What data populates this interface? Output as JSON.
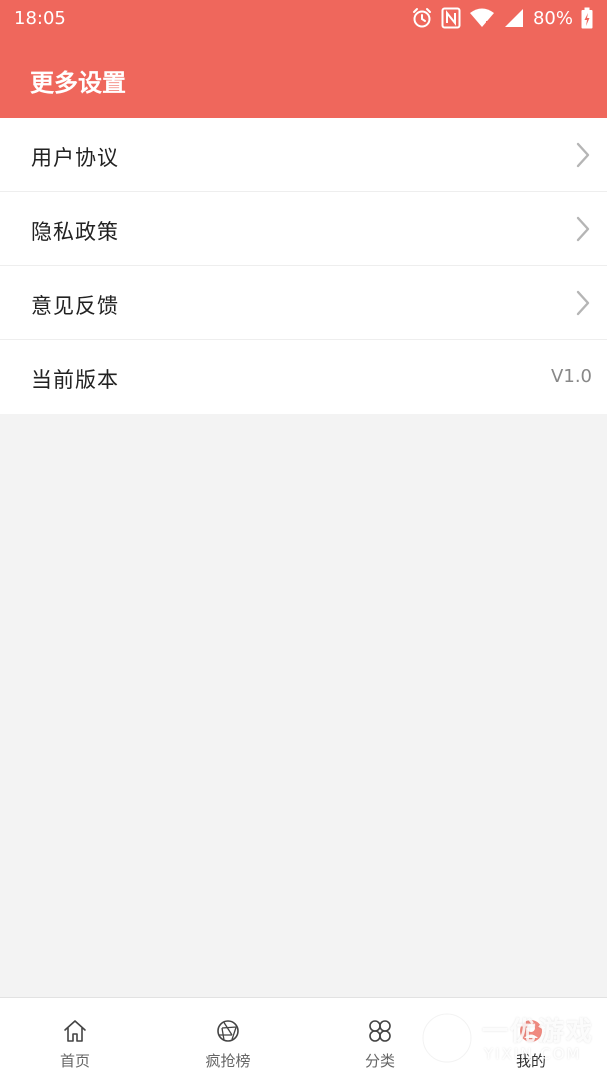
{
  "status_bar": {
    "time": "18:05",
    "battery": "80%",
    "icons": [
      "alarm-icon",
      "nfc-icon",
      "wifi-icon",
      "signal-icon",
      "battery-icon"
    ]
  },
  "header": {
    "title": "更多设置",
    "background": "#ef675c"
  },
  "menu": {
    "items": [
      {
        "label": "用户协议",
        "icon": "chevron-right-icon"
      },
      {
        "label": "隐私政策",
        "icon": "chevron-right-icon"
      },
      {
        "label": "意见反馈",
        "icon": "chevron-right-icon"
      },
      {
        "label": "当前版本",
        "value": "V1.0"
      }
    ]
  },
  "tabbar": {
    "tabs": [
      {
        "label": "首页",
        "icon": "home-icon"
      },
      {
        "label": "疯抢榜",
        "icon": "aperture-icon"
      },
      {
        "label": "分类",
        "icon": "category-icon"
      },
      {
        "label": "我的",
        "icon": "profile-icon",
        "active": true
      }
    ]
  },
  "watermark": {
    "text": "一优游戏",
    "sub": "YIXIN.COM"
  }
}
